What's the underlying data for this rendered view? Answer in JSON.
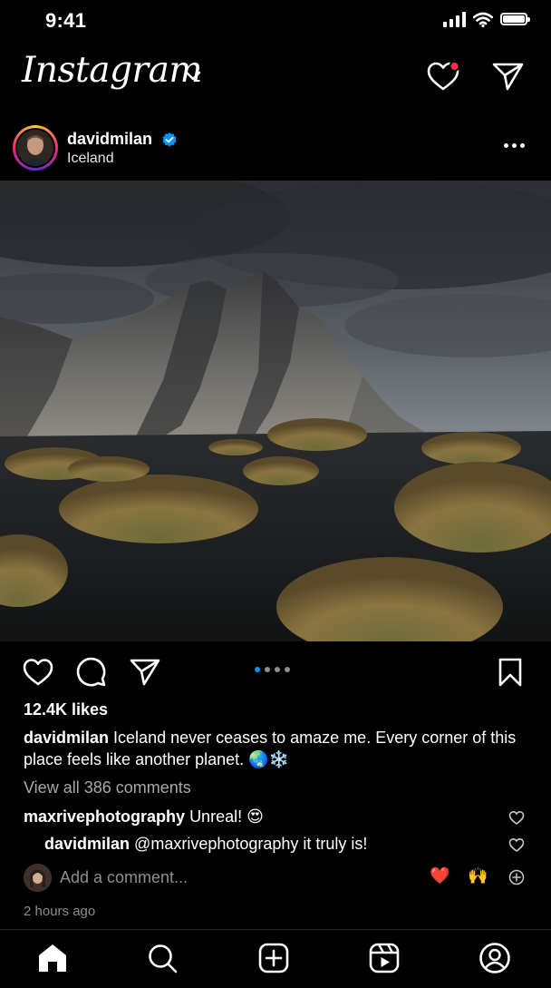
{
  "status_bar": {
    "time": "9:41"
  },
  "header": {
    "logo_text": "Instagram"
  },
  "post": {
    "username": "davidmilan",
    "location": "Iceland",
    "likes": "12.4K likes",
    "caption_username": "davidmilan",
    "caption_text": "Iceland never ceases to amaze me. Every corner of this place feels like another planet. 🌏❄️",
    "carousel_count": 4,
    "carousel_active": 0,
    "view_all_comments": "View all 386 comments",
    "comments": [
      {
        "username": "maxrivephotography",
        "text": "Unreal! 😍"
      },
      {
        "username": "davidmilan",
        "text": "@maxrivephotography it truly is!"
      }
    ],
    "add_comment_placeholder": "Add a comment...",
    "quick_reactions": [
      "❤️",
      "🙌"
    ],
    "timestamp": "2 hours ago"
  },
  "colors": {
    "background": "#000000",
    "accent": "#0095f6",
    "notification_dot": "#ff3040",
    "verified": "#0095f6",
    "secondary_text": "#a8a8a8"
  },
  "icons": {
    "header": [
      "heart-icon",
      "send-icon"
    ],
    "actions": [
      "heart-icon",
      "comment-icon",
      "send-icon",
      "bookmark-icon"
    ],
    "tabs": [
      "home-icon",
      "search-icon",
      "create-icon",
      "reels-icon",
      "profile-icon"
    ]
  }
}
